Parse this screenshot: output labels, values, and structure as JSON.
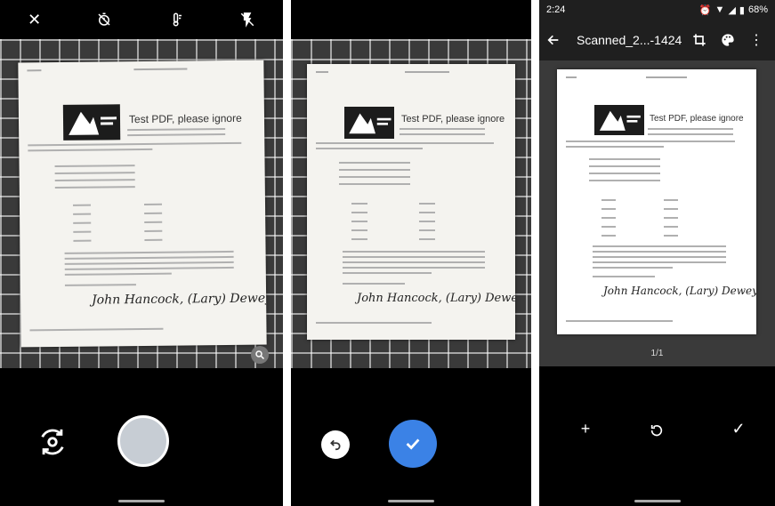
{
  "document": {
    "title": "Test PDF, please ignore"
  },
  "signature_text": "John Hancock, (Lary) Dewey",
  "camera_screen": {
    "close_icon": "✕",
    "timer_icon": "timer-off",
    "exposure_icon": "thermometer",
    "flash_icon": "flash-off"
  },
  "confirm_screen": {
    "undo_icon": "undo",
    "confirm_icon": "check"
  },
  "pdf_screen": {
    "status_time": "2:24",
    "status_battery": "68%",
    "file_title": "Scanned_2...-1424.pdf",
    "page_counter": "1/1",
    "add_label": "+",
    "done_label": "✓"
  },
  "colors": {
    "confirm_blue": "#3b82e6",
    "shutter_gray": "#c7cdd4",
    "appbar_dark": "#1f1f1f"
  }
}
